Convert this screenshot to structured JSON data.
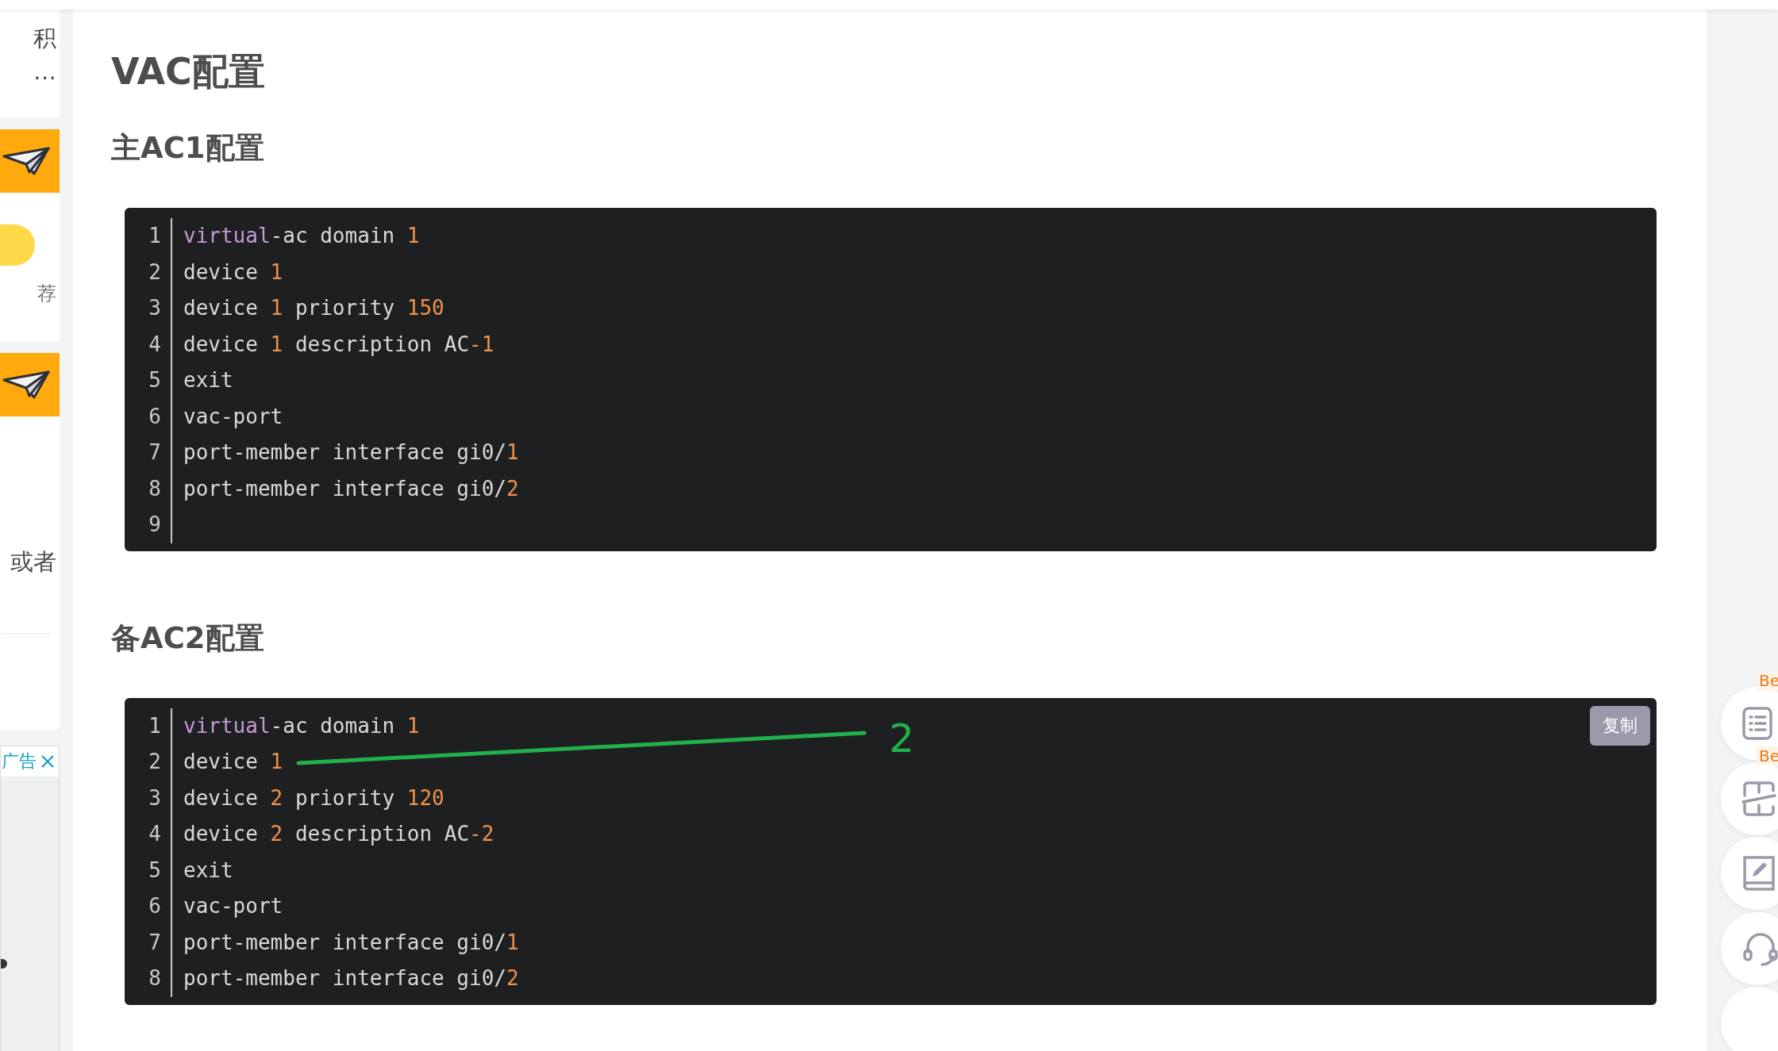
{
  "sidebar": {
    "items": [
      {
        "kind": "text",
        "lines": [
          "积",
          "…"
        ]
      },
      {
        "kind": "banner"
      },
      {
        "kind": "recommend",
        "label": "荐"
      },
      {
        "kind": "banner"
      },
      {
        "kind": "text",
        "lines": [
          "或者"
        ]
      }
    ],
    "ad": {
      "label": "广告"
    }
  },
  "article": {
    "title": "VAC配置",
    "sections": [
      {
        "heading": "主AC1配置",
        "lines": [
          {
            "number": "1",
            "tokens": [
              {
                "text": "virtual",
                "kind": "keyword"
              },
              {
                "text": "-ac domain ",
                "kind": "plain"
              },
              {
                "text": "1",
                "kind": "number"
              }
            ]
          },
          {
            "number": "2",
            "tokens": [
              {
                "text": "device ",
                "kind": "plain"
              },
              {
                "text": "1",
                "kind": "number"
              }
            ]
          },
          {
            "number": "3",
            "tokens": [
              {
                "text": "device ",
                "kind": "plain"
              },
              {
                "text": "1",
                "kind": "number"
              },
              {
                "text": " priority ",
                "kind": "plain"
              },
              {
                "text": "150",
                "kind": "number"
              }
            ]
          },
          {
            "number": "4",
            "tokens": [
              {
                "text": "device ",
                "kind": "plain"
              },
              {
                "text": "1",
                "kind": "number"
              },
              {
                "text": " description AC",
                "kind": "plain"
              },
              {
                "text": "-1",
                "kind": "number"
              }
            ]
          },
          {
            "number": "5",
            "tokens": [
              {
                "text": "exit",
                "kind": "plain"
              }
            ]
          },
          {
            "number": "6",
            "tokens": [
              {
                "text": "vac-port",
                "kind": "plain"
              }
            ]
          },
          {
            "number": "7",
            "tokens": [
              {
                "text": "port-member interface gi0/",
                "kind": "plain"
              },
              {
                "text": "1",
                "kind": "number"
              }
            ]
          },
          {
            "number": "8",
            "tokens": [
              {
                "text": "port-member interface gi0/",
                "kind": "plain"
              },
              {
                "text": "2",
                "kind": "number"
              }
            ]
          },
          {
            "number": "9"
          }
        ]
      },
      {
        "heading": "备AC2配置",
        "copy_button": "复制",
        "annotation": {
          "label": "2"
        },
        "lines": [
          {
            "number": "1",
            "tokens": [
              {
                "text": "virtual",
                "kind": "keyword"
              },
              {
                "text": "-ac domain ",
                "kind": "plain"
              },
              {
                "text": "1",
                "kind": "number"
              }
            ]
          },
          {
            "number": "2",
            "tokens": [
              {
                "text": "device ",
                "kind": "plain"
              },
              {
                "text": "1",
                "kind": "number"
              }
            ]
          },
          {
            "number": "3",
            "tokens": [
              {
                "text": "device ",
                "kind": "plain"
              },
              {
                "text": "2",
                "kind": "number"
              },
              {
                "text": " priority ",
                "kind": "plain"
              },
              {
                "text": "120",
                "kind": "number"
              }
            ]
          },
          {
            "number": "4",
            "tokens": [
              {
                "text": "device ",
                "kind": "plain"
              },
              {
                "text": "2",
                "kind": "number"
              },
              {
                "text": " description AC",
                "kind": "plain"
              },
              {
                "text": "-2",
                "kind": "number"
              }
            ]
          },
          {
            "number": "5",
            "tokens": [
              {
                "text": "exit",
                "kind": "plain"
              }
            ]
          },
          {
            "number": "6",
            "tokens": [
              {
                "text": "vac-port",
                "kind": "plain"
              }
            ]
          },
          {
            "number": "7",
            "tokens": [
              {
                "text": "port-member interface gi0/",
                "kind": "plain"
              },
              {
                "text": "1",
                "kind": "number"
              }
            ]
          },
          {
            "number": "8",
            "tokens": [
              {
                "text": "port-member interface gi0/",
                "kind": "plain"
              },
              {
                "text": "2",
                "kind": "number"
              }
            ]
          }
        ]
      }
    ]
  },
  "tools": [
    {
      "kind": "list",
      "badge": "Be"
    },
    {
      "kind": "ruler",
      "badge": "Be"
    },
    {
      "kind": "edit"
    },
    {
      "kind": "headset"
    },
    {
      "kind": "blank"
    }
  ]
}
